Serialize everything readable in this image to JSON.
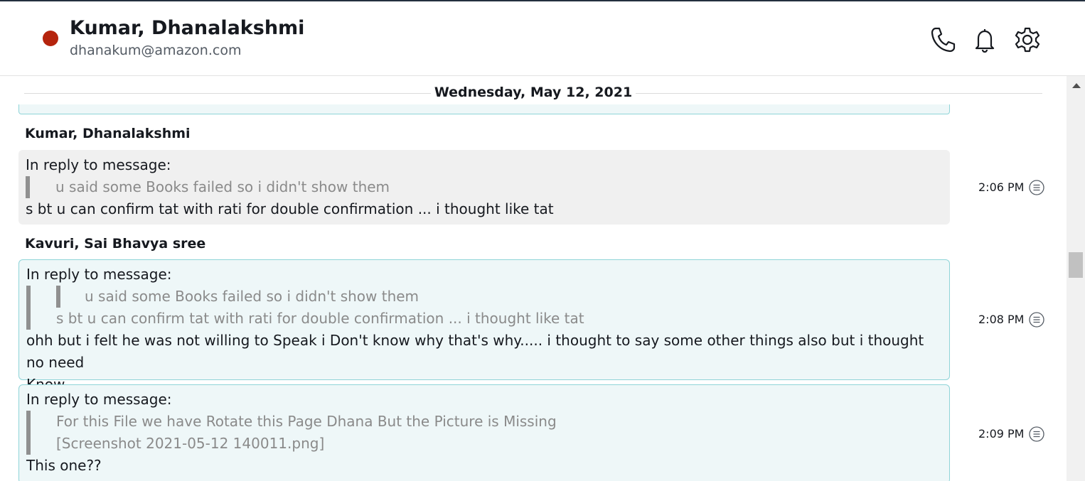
{
  "header": {
    "contact_name": "Kumar, Dhanalakshmi",
    "contact_email": "dhanakum@amazon.com",
    "status_color": "#b5240d",
    "icons": [
      "phone-icon",
      "bell-icon",
      "gear-icon"
    ]
  },
  "conversation": {
    "date_label": "Wednesday, May 12, 2021",
    "groups": [
      {
        "sender": "Kumar, Dhanalakshmi",
        "messages": [
          {
            "reply_label": "In reply to message:",
            "quoted": "u said some Books failed so i didn't show them",
            "text": "s bt u can confirm tat with rati for double confirmation ... i thought like tat",
            "time": "2:06 PM"
          }
        ]
      },
      {
        "sender": "Kavuri, Sai Bhavya sree",
        "messages": [
          {
            "reply_label": "In reply to message:",
            "nested_quoted": "u said some Books failed so i didn't show them",
            "quoted": "s bt u can confirm tat with rati for double confirmation ... i thought like tat",
            "text_line1": "ohh but i felt he was not willing to Speak i Don't know why that's why..... i thought to say some other things also but i thought no need",
            "text_line2": "Know",
            "time": "2:08 PM"
          },
          {
            "reply_label": "In reply to message:",
            "quoted_line1": "For this File we have Rotate this Page Dhana But the Picture is Missing",
            "quoted_line2": "[Screenshot 2021-05-12 140011.png]",
            "text": "This one??",
            "time": "2:09 PM"
          }
        ]
      }
    ]
  }
}
